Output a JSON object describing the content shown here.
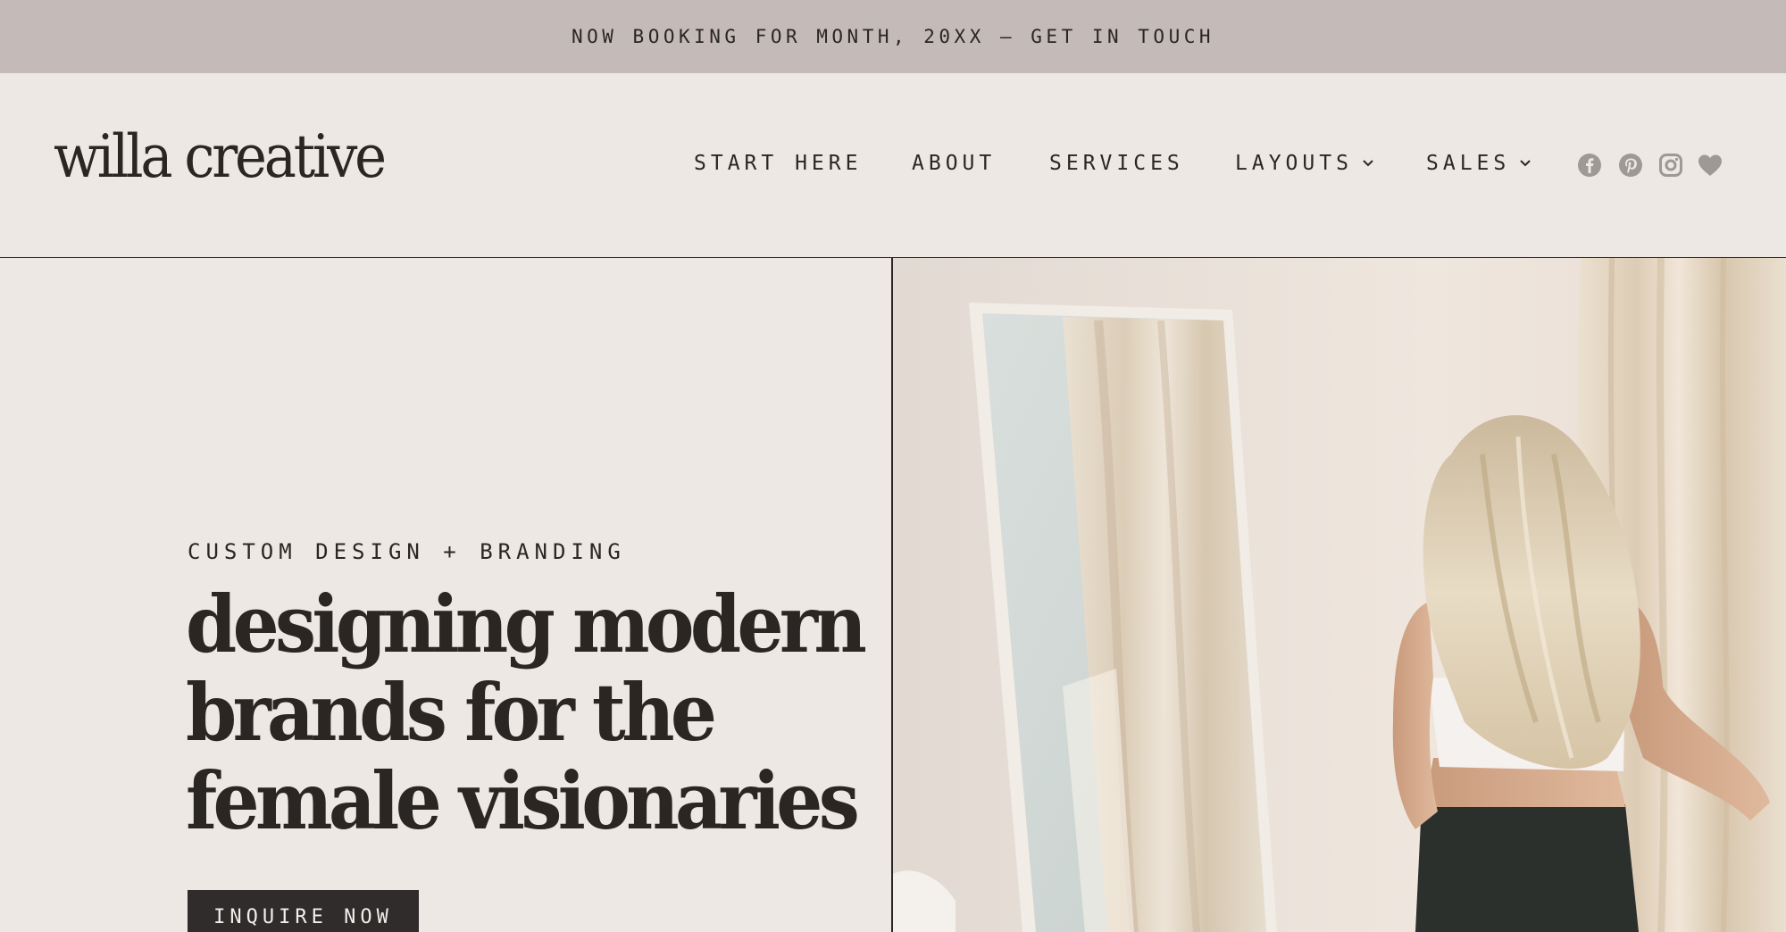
{
  "announcement": {
    "text": "NOW BOOKING FOR MONTH, 20XX — GET IN TOUCH"
  },
  "header": {
    "logo": "willa creative",
    "nav": [
      {
        "label": "START HERE",
        "has_dropdown": false
      },
      {
        "label": "ABOUT",
        "has_dropdown": false
      },
      {
        "label": "SERVICES",
        "has_dropdown": false
      },
      {
        "label": "LAYOUTS",
        "has_dropdown": true
      },
      {
        "label": "SALES",
        "has_dropdown": true
      }
    ],
    "social_icons": [
      "facebook-icon",
      "pinterest-icon",
      "instagram-icon",
      "heart-icon"
    ]
  },
  "hero": {
    "eyebrow": "CUSTOM DESIGN + BRANDING",
    "headline_lines": [
      "designing modern",
      "brands for the",
      "female visionaries"
    ],
    "cta_label": "INQUIRE NOW",
    "photo_alt": "woman with long blonde hair standing in front of a floor mirror"
  },
  "colors": {
    "announcement_bg": "#c4bbb8",
    "page_bg": "#ede8e4",
    "text": "#2a2624",
    "button_bg": "#2f2c2b",
    "icon_gray": "#9e9896"
  }
}
